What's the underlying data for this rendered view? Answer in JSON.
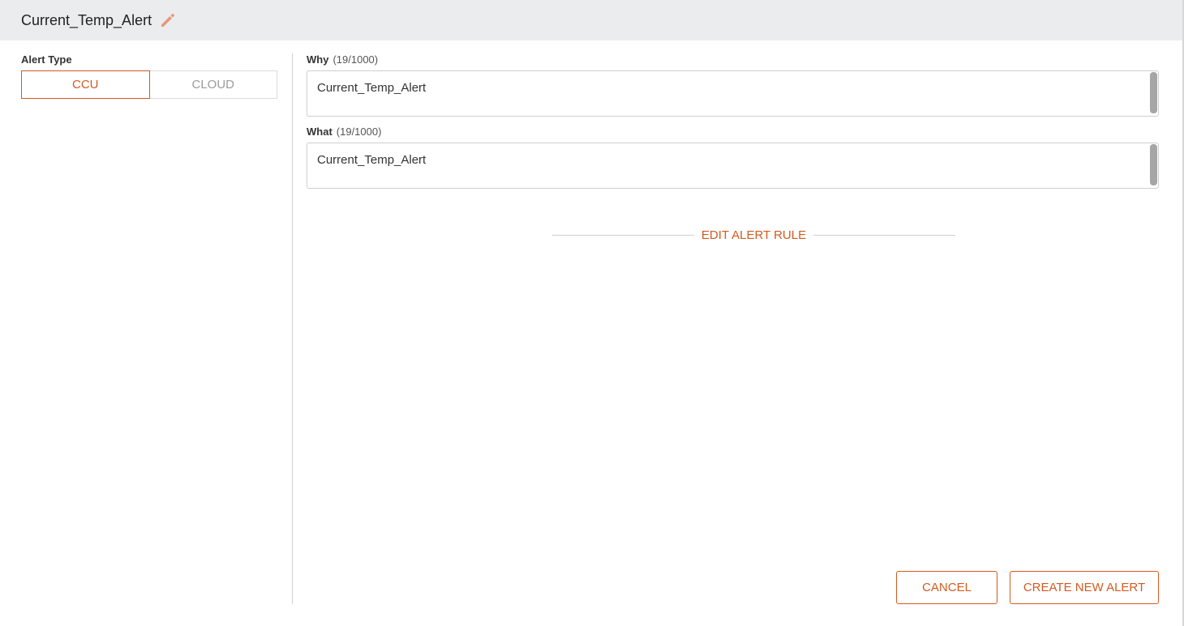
{
  "header": {
    "title": "Current_Temp_Alert",
    "edit_icon": "pencil-icon"
  },
  "alert_type": {
    "label": "Alert Type",
    "options": [
      {
        "label": "CCU",
        "selected": true
      },
      {
        "label": "CLOUD",
        "selected": false
      }
    ]
  },
  "why": {
    "label": "Why",
    "count": "(19/1000)",
    "value": "Current_Temp_Alert"
  },
  "what": {
    "label": "What",
    "count": "(19/1000)",
    "value": "Current_Temp_Alert"
  },
  "rule_section": {
    "label": "EDIT ALERT RULE"
  },
  "actions": {
    "cancel": "CANCEL",
    "create": "CREATE NEW ALERT"
  },
  "colors": {
    "accent": "#d35a1f",
    "header_bg": "#ebeced",
    "edit_icon": "#e8967a"
  }
}
